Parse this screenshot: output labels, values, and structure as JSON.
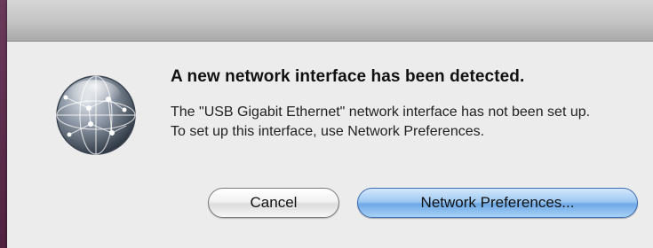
{
  "dialog": {
    "heading": "A new network interface has been detected.",
    "message": "The \"USB Gigabit Ethernet\" network interface has not been set up. To set up this interface, use Network Preferences.",
    "icon": "network-globe-icon"
  },
  "buttons": {
    "cancel_label": "Cancel",
    "default_label": "Network Preferences..."
  },
  "colors": {
    "default_button": "#8fc1f0",
    "window_background": "#ececec",
    "titlebar": "#c3c3c3",
    "desktop": "#5a2a4a"
  }
}
